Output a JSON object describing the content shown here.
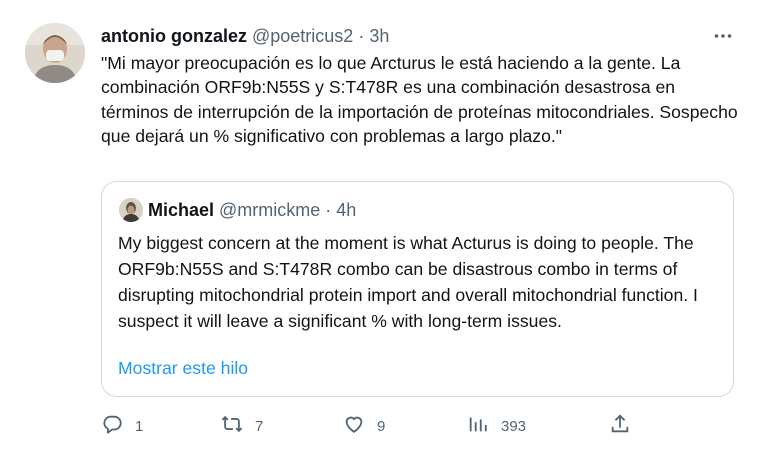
{
  "tweet": {
    "author_name": "antonio gonzalez",
    "author_handle": "@poetricus2",
    "separator": "·",
    "time": "3h",
    "text": "\"Mi mayor preocupación es lo que Arcturus le está haciendo a la gente. La combinación ORF9b:N55S y S:T478R es una combinación desastrosa en términos de interrupción de la importación de proteínas mitocondriales. Sospecho que dejará un % significativo con problemas a largo plazo.\"",
    "more_icon": "more-horizontal-icon"
  },
  "quote": {
    "author_name": "Michael",
    "author_handle": "@mrmickme",
    "separator": "·",
    "time": "4h",
    "text": "My biggest concern at the moment is what Acturus is doing to people. The ORF9b:N55S and S:T478R combo can be disastrous combo in terms of disrupting mitochondrial protein import and overall mitochondrial function. I suspect it will leave a significant % with long-term issues.",
    "show_thread_label": "Mostrar este hilo"
  },
  "actions": {
    "replies": "1",
    "retweets": "7",
    "likes": "9",
    "views": "393",
    "icons": [
      "reply-icon",
      "retweet-icon",
      "like-icon",
      "views-icon",
      "share-icon"
    ]
  },
  "colors": {
    "text": "#0f1419",
    "secondary": "#536471",
    "link": "#1d9bf0",
    "border": "#cfd9de"
  }
}
